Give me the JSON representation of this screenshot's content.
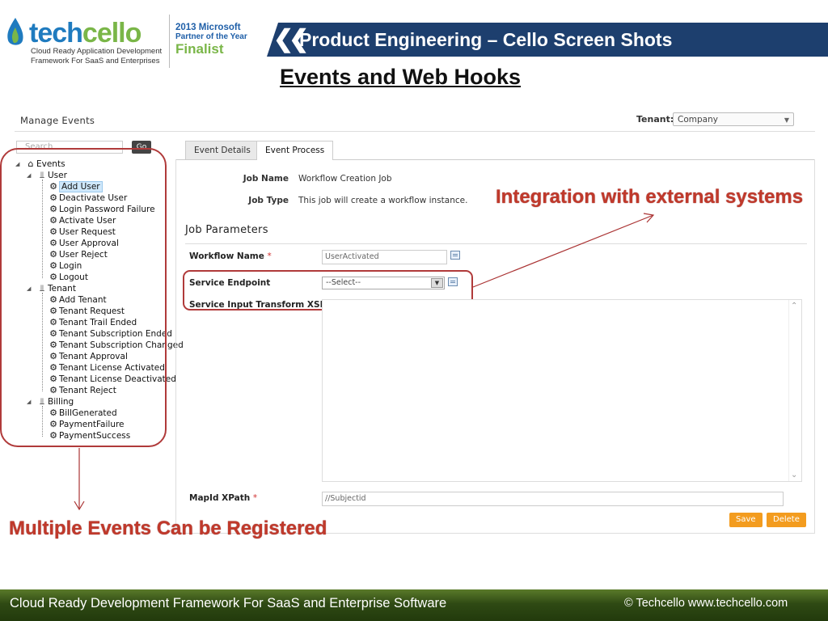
{
  "header": {
    "logo_text_a": "tech",
    "logo_text_b": "cello",
    "logo_tagline_1": "Cloud Ready Application Development",
    "logo_tagline_2": "Framework For SaaS and Enterprises",
    "award_line_1": "2013 Microsoft",
    "award_line_2": "Partner of the Year",
    "award_line_3": "Finalist",
    "banner_title": "Product Engineering – Cello Screen Shots"
  },
  "slide_title": "Events and Web Hooks",
  "app": {
    "page_title": "Manage Events",
    "tenant_label": "Tenant:",
    "tenant_value": "Company",
    "search_placeholder": "Search",
    "search_button": "Go",
    "tree": {
      "root": "Events",
      "groups": [
        {
          "label": "User",
          "items": [
            "Add User",
            "Deactivate User",
            "Login Password Failure",
            "Activate User",
            "User Request",
            "User Approval",
            "User Reject",
            "Login",
            "Logout"
          ]
        },
        {
          "label": "Tenant",
          "items": [
            "Add Tenant",
            "Tenant Request",
            "Tenant Trail Ended",
            "Tenant Subscription Ended",
            "Tenant Subscription Changed",
            "Tenant Approval",
            "Tenant License Activated",
            "Tenant License Deactivated",
            "Tenant Reject"
          ]
        },
        {
          "label": "Billing",
          "items": [
            "BillGenerated",
            "PaymentFailure",
            "PaymentSuccess"
          ]
        }
      ],
      "selected": "Add User"
    },
    "tabs": [
      {
        "label": "Event Details",
        "active": false
      },
      {
        "label": "Event Process",
        "active": true
      }
    ],
    "job_name_label": "Job Name",
    "job_name_value": "Workflow Creation Job",
    "job_type_label": "Job Type",
    "job_type_value": "This job will create a workflow instance.",
    "params_title": "Job Parameters",
    "workflow_name_label": "Workflow Name",
    "workflow_name_value": "UserActivated",
    "service_endpoint_label": "Service Endpoint",
    "service_endpoint_value": "--Select--",
    "service_xsl_label": "Service Input Transform XSL",
    "mapid_label": "MapId XPath",
    "mapid_value": "//Subjectid",
    "required_marker": "*",
    "save_button": "Save",
    "delete_button": "Delete"
  },
  "callouts": {
    "integration": "Integration with external systems",
    "multiple_events": "Multiple Events Can  be Registered"
  },
  "footer": {
    "left": "Cloud Ready Development Framework For SaaS and Enterprise Software",
    "right": "© Techcello www.techcello.com"
  },
  "colors": {
    "brand_blue": "#1f7bbf",
    "brand_green": "#7ab648",
    "banner": "#1d3f6e",
    "callout_red": "#c0392b",
    "action_orange": "#f39c1f",
    "footer_green": "#2f4a14"
  }
}
